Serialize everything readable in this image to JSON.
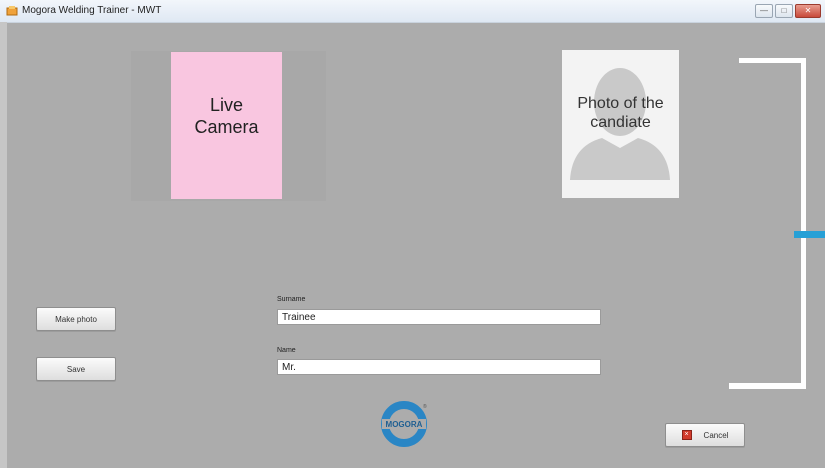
{
  "window": {
    "title": "Mogora Welding Trainer - MWT",
    "controls": {
      "minimize": "—",
      "maximize": "□",
      "close": "✕"
    }
  },
  "camera": {
    "label": "Live Camera",
    "background": "#f9c6e0"
  },
  "photo": {
    "label": "Photo of the candiate"
  },
  "buttons": {
    "make_photo": "Make photo",
    "save": "Save",
    "cancel": "Cancel"
  },
  "form": {
    "surname": {
      "label": "Surname",
      "value": "Trainee"
    },
    "name": {
      "label": "Name",
      "value": "Mr."
    }
  },
  "logo": {
    "text": "MOGORA",
    "trademark": "®",
    "color": "#2a86c5"
  },
  "colors": {
    "accent": "#27a0d6",
    "background": "#acacac",
    "cancel_icon": "#d23b2c"
  }
}
